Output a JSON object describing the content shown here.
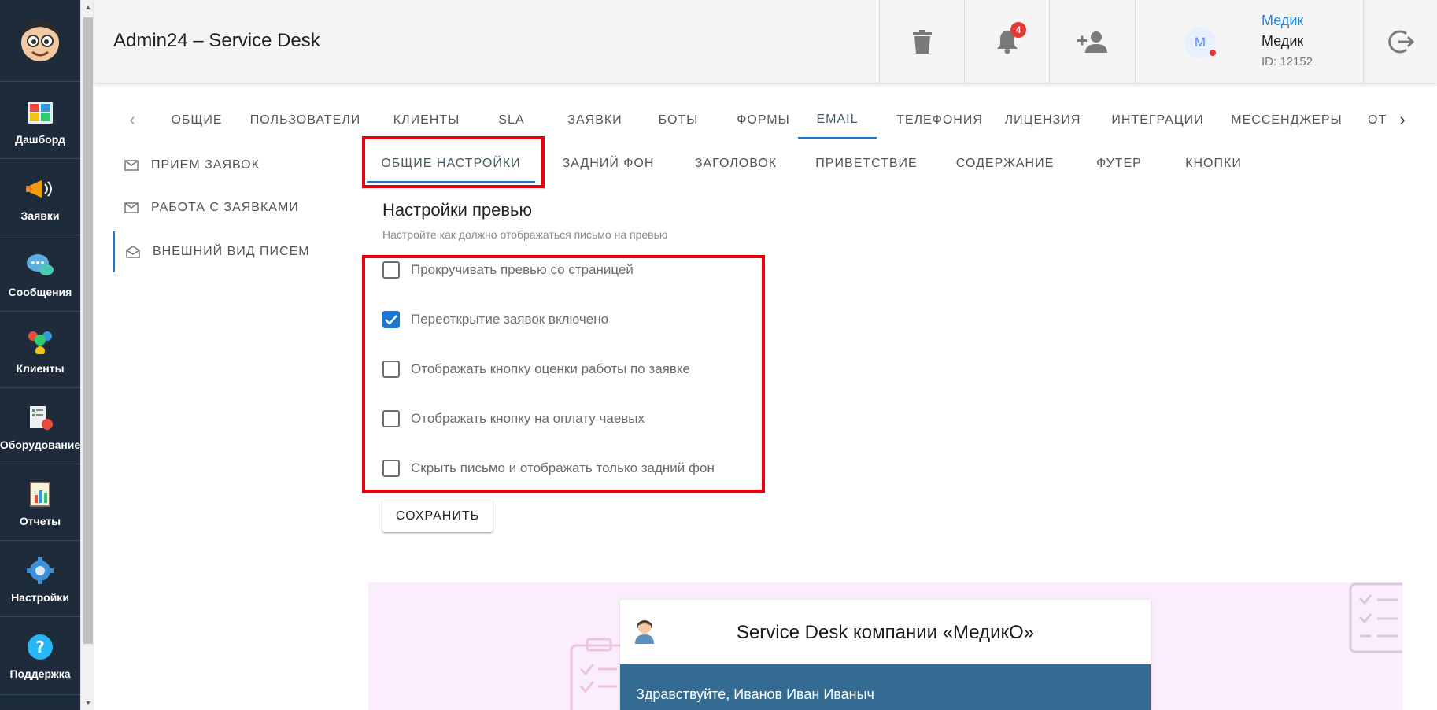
{
  "app": {
    "title": "Admin24 – Service Desk"
  },
  "colors": {
    "sidebar_bg": "#1d2b3a",
    "accent": "#1976d2",
    "highlight_box": "#e8000d",
    "badge": "#e53935",
    "email_header": "#336b92",
    "preview_bg": "#fbeefc"
  },
  "sidebar": {
    "items": [
      {
        "label": "Дашборд",
        "icon": "dashboard-icon"
      },
      {
        "label": "Заявки",
        "icon": "megaphone-icon"
      },
      {
        "label": "Сообщения",
        "icon": "chat-bubbles-icon"
      },
      {
        "label": "Клиенты",
        "icon": "clients-icon"
      },
      {
        "label": "Оборудование",
        "icon": "equipment-icon"
      },
      {
        "label": "Отчеты",
        "icon": "reports-icon"
      },
      {
        "label": "Настройки",
        "icon": "gear-icon"
      },
      {
        "label": "Поддержка",
        "icon": "help-icon"
      }
    ]
  },
  "header": {
    "notifications_count": "4",
    "user": {
      "link": "Медик",
      "name": "Медик",
      "id": "ID: 12152",
      "avatar": "М"
    }
  },
  "top_tabs": [
    "ОБЩИЕ",
    "ПОЛЬЗОВАТЕЛИ",
    "КЛИЕНТЫ",
    "SLA",
    "ЗАЯВКИ",
    "БОТЫ",
    "ФОРМЫ",
    "EMAIL",
    "ТЕЛЕФОНИЯ",
    "ЛИЦЕНЗИЯ",
    "ИНТЕГРАЦИИ",
    "МЕССЕНДЖЕРЫ",
    "ОТ"
  ],
  "active_top_tab": "EMAIL",
  "subnav": [
    "ПРИЕМ ЗАЯВОК",
    "РАБОТА С ЗАЯВКАМИ",
    "ВНЕШНИЙ ВИД ПИСЕМ"
  ],
  "sub_tabs": [
    "ОБЩИЕ НАСТРОЙКИ",
    "ЗАДНИЙ ФОН",
    "ЗАГОЛОВОК",
    "ПРИВЕТСТВИЕ",
    "СОДЕРЖАНИЕ",
    "ФУТЕР",
    "КНОПКИ"
  ],
  "section": {
    "title": "Настройки превью",
    "subtitle": "Настройте как должно отображаться письмо на превью"
  },
  "checkboxes": [
    {
      "label": "Прокручивать превью со страницей",
      "checked": false
    },
    {
      "label": "Переоткрытие заявок включено",
      "checked": true
    },
    {
      "label": "Отображать кнопку оценки работы по заявке",
      "checked": false
    },
    {
      "label": "Отображать кнопку на оплату чаевых",
      "checked": false
    },
    {
      "label": "Скрыть письмо и отображать только задний фон",
      "checked": false
    }
  ],
  "save_label": "СОХРАНИТЬ",
  "preview": {
    "title": "Service Desk компании «МедикО»",
    "greeting": "Здравствуйте, Иванов Иван Иваныч"
  }
}
